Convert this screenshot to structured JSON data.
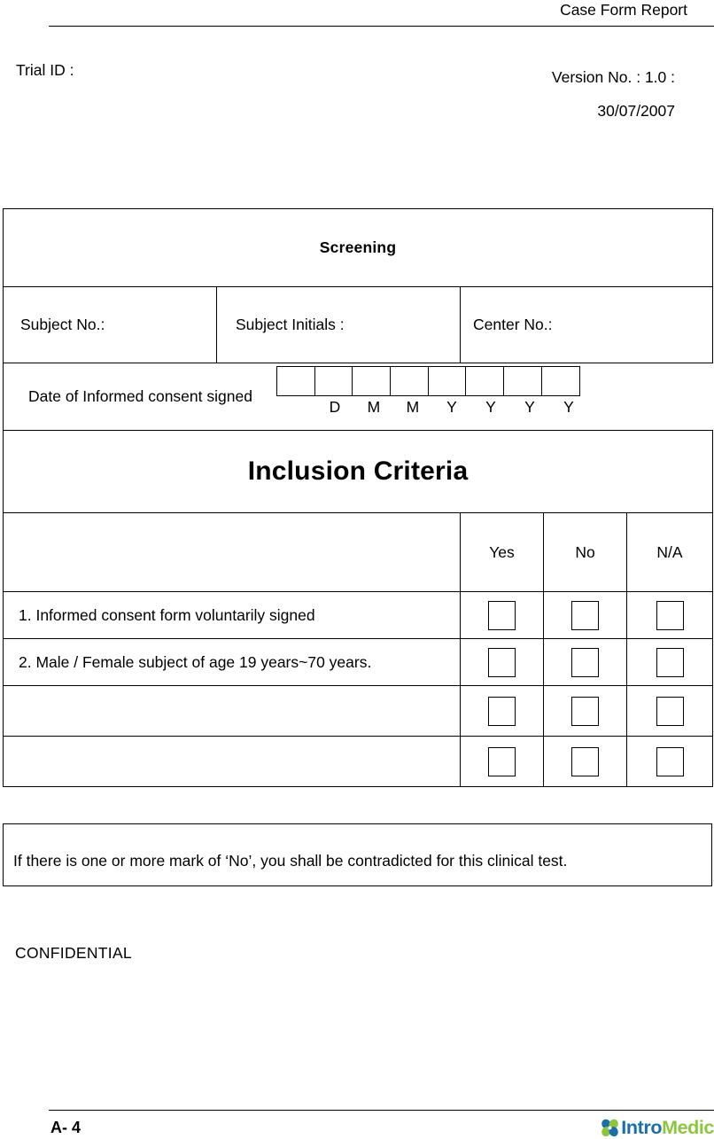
{
  "header": {
    "report_title": "Case Form Report",
    "trial_id_label": "Trial ID :",
    "version_line1": "Version No. : 1.0 :",
    "version_line2": "30/07/2007"
  },
  "form": {
    "screening_title": "Screening",
    "subject_no_label": "Subject No.:",
    "subject_initials_label": "Subject Initials :",
    "center_no_label": "Center No.:",
    "consent_date": {
      "label": "Date of Informed consent signed",
      "box_count": 8,
      "letters": [
        "D",
        "M",
        "M",
        "Y",
        "Y",
        "Y",
        "Y"
      ]
    },
    "inclusion_title": "Inclusion Criteria",
    "criteria_headers": [
      "",
      "Yes",
      "No",
      "N/A"
    ],
    "criteria_rows": [
      {
        "text": "1. Informed consent form voluntarily signed",
        "yes": "",
        "no": "",
        "na": ""
      },
      {
        "text": "2. Male / Female subject of age 19 years~70 years.",
        "yes": "",
        "no": "",
        "na": ""
      },
      {
        "text": "",
        "yes": "",
        "no": "",
        "na": ""
      },
      {
        "text": "",
        "yes": "",
        "no": "",
        "na": ""
      }
    ]
  },
  "note": {
    "text": "If there is one or more mark of ‘No’, you shall be contradicted for this clinical test."
  },
  "confidential": {
    "label": "CONFIDENTIAL"
  },
  "footer": {
    "page_number": "A- 4",
    "logo_part1": "Intro",
    "logo_part2": "Medic",
    "logo_color_blue": "#1b6fa8",
    "logo_color_green": "#8cc63e"
  }
}
